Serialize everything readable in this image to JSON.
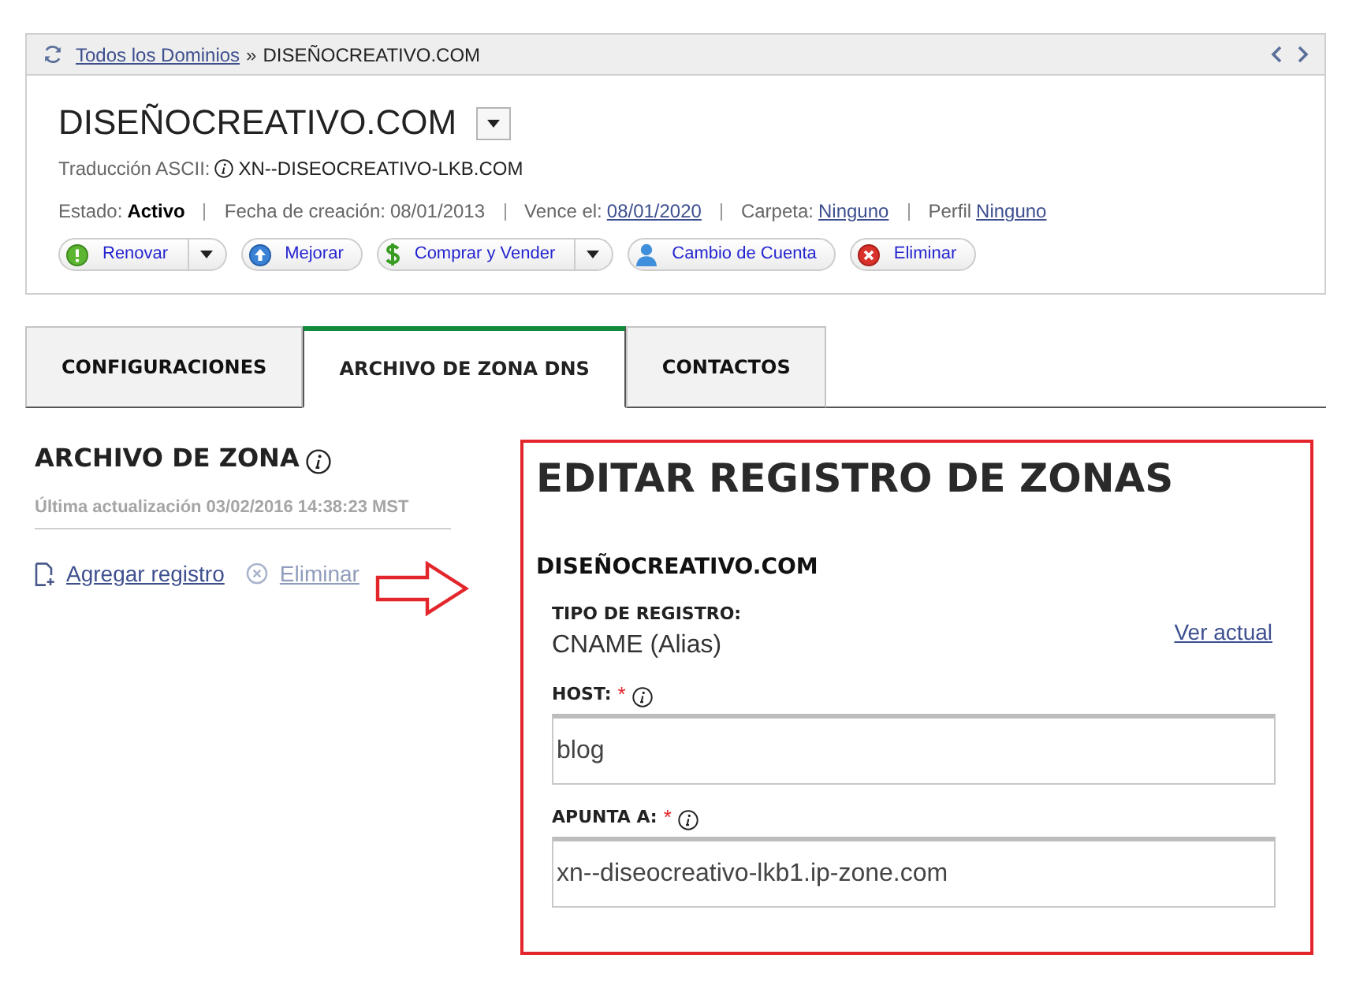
{
  "breadcrumb": {
    "link": "Todos los Dominios",
    "separator": "»",
    "current": "DISEÑOCREATIVO.COM"
  },
  "domain": {
    "title": "DISEÑOCREATIVO.COM",
    "ascii_label": "Traducción ASCII:",
    "ascii_value": "XN--DISEOCREATIVO-LKB.COM",
    "meta": [
      {
        "label": "Estado:",
        "value": "Activo",
        "kind": "bold"
      },
      {
        "label": "Fecha de creación:",
        "value": "08/01/2013",
        "kind": "plain"
      },
      {
        "label": "Vence el:",
        "value": "08/01/2020",
        "kind": "link"
      },
      {
        "label": "Carpeta:",
        "value": "Ninguno",
        "kind": "link"
      },
      {
        "label": "Perfil",
        "value": "Ninguno",
        "kind": "link"
      }
    ],
    "actions": [
      {
        "label": "Renovar",
        "kind": "alert",
        "dropdown": true
      },
      {
        "label": "Mejorar",
        "kind": "upgrade",
        "dropdown": false
      },
      {
        "label": "Comprar y Vender",
        "kind": "dollar",
        "dropdown": true
      },
      {
        "label": "Cambio de Cuenta",
        "kind": "user",
        "dropdown": false
      },
      {
        "label": "Eliminar",
        "kind": "delete",
        "dropdown": false
      }
    ]
  },
  "tabs": [
    {
      "label": "CONFIGURACIONES",
      "selected": false
    },
    {
      "label": "ARCHIVO DE ZONA DNS",
      "selected": true
    },
    {
      "label": "CONTACTOS",
      "selected": false
    }
  ],
  "zone_file": {
    "title": "ARCHIVO DE ZONA",
    "updated": "Última actualización 03/02/2016 14:38:23 MST",
    "actions": [
      {
        "label": "Agregar registro",
        "kind": "add",
        "disabled": false
      },
      {
        "label": "Eliminar",
        "kind": "remove",
        "disabled": true
      }
    ]
  },
  "editor": {
    "title": "EDITAR REGISTRO DE ZONAS",
    "domain": "DISEÑOCREATIVO.COM",
    "record_type": {
      "label": "TIPO DE REGISTRO:",
      "value": "CNAME (Alias)"
    },
    "view_current": "Ver actual",
    "fields": [
      {
        "label": "HOST:",
        "required_mark": "*",
        "value": "blog"
      },
      {
        "label": "APUNTA A:",
        "required_mark": "*",
        "value": "xn--diseocreativo-lkb1.ip-zone.com"
      }
    ]
  }
}
